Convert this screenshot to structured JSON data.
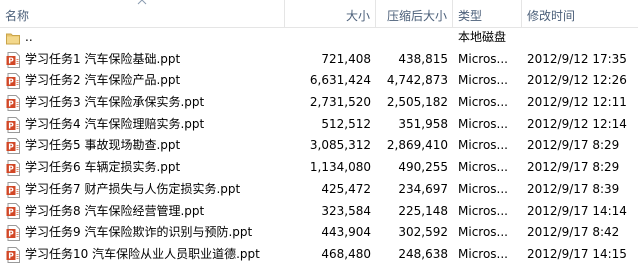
{
  "columns": {
    "name": "名称",
    "size": "大小",
    "compressed": "压缩后大小",
    "type": "类型",
    "modified": "修改时间"
  },
  "rows": [
    {
      "icon": "folder-up-icon",
      "name": "..",
      "size": "",
      "compressed": "",
      "type": "本地磁盘",
      "modified": ""
    },
    {
      "icon": "ppt-file-icon",
      "name": "学习任务1 汽车保险基础.ppt",
      "size": "721,408",
      "compressed": "438,815",
      "type": "Micros...",
      "modified": "2012/9/12 17:35"
    },
    {
      "icon": "ppt-file-icon",
      "name": "学习任务2 汽车保险产品.ppt",
      "size": "6,631,424",
      "compressed": "4,742,873",
      "type": "Micros...",
      "modified": "2012/9/12 12:26"
    },
    {
      "icon": "ppt-file-icon",
      "name": "学习任务3 汽车保险承保实务.ppt",
      "size": "2,731,520",
      "compressed": "2,505,182",
      "type": "Micros...",
      "modified": "2012/9/12 12:11"
    },
    {
      "icon": "ppt-file-icon",
      "name": "学习任务4 汽车保险理赔实务.ppt",
      "size": "512,512",
      "compressed": "351,958",
      "type": "Micros...",
      "modified": "2012/9/12 12:14"
    },
    {
      "icon": "ppt-file-icon",
      "name": "学习任务5 事故现场勘查.ppt",
      "size": "3,085,312",
      "compressed": "2,869,410",
      "type": "Micros...",
      "modified": "2012/9/17 8:29"
    },
    {
      "icon": "ppt-file-icon",
      "name": "学习任务6 车辆定损实务.ppt",
      "size": "1,134,080",
      "compressed": "490,255",
      "type": "Micros...",
      "modified": "2012/9/17 8:29"
    },
    {
      "icon": "ppt-file-icon",
      "name": "学习任务7 财产损失与人伤定损实务.ppt",
      "size": "425,472",
      "compressed": "234,697",
      "type": "Micros...",
      "modified": "2012/9/17 8:39"
    },
    {
      "icon": "ppt-file-icon",
      "name": "学习任务8 汽车保险经营管理.ppt",
      "size": "323,584",
      "compressed": "225,148",
      "type": "Micros...",
      "modified": "2012/9/17 14:14"
    },
    {
      "icon": "ppt-file-icon",
      "name": "学习任务9 汽车保险欺诈的识别与预防.ppt",
      "size": "443,904",
      "compressed": "302,592",
      "type": "Micros...",
      "modified": "2012/9/17 8:42"
    },
    {
      "icon": "ppt-file-icon",
      "name": "学习任务10 汽车保险从业人员职业道德.ppt",
      "size": "468,480",
      "compressed": "248,638",
      "type": "Micros...",
      "modified": "2012/9/17 14:15"
    }
  ],
  "colors": {
    "header_text": "#4c607a",
    "ppt_icon": "#d24726",
    "folder_icon": "#e8c36a"
  }
}
